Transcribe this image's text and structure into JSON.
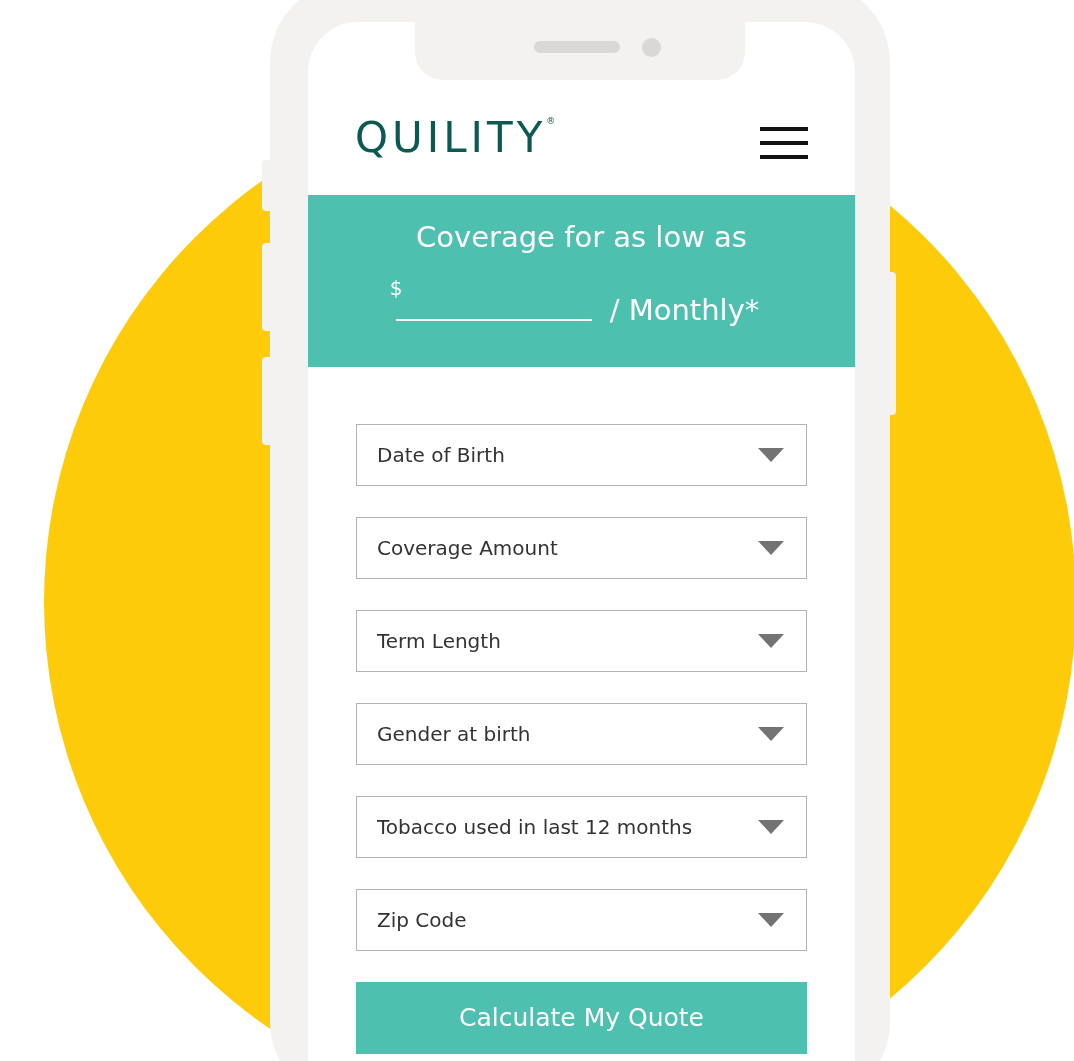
{
  "header": {
    "logo": "QUILITY",
    "logo_mark": "®"
  },
  "banner": {
    "title": "Coverage for as low as",
    "currency": "$",
    "period": "/ Monthly*"
  },
  "fields": [
    {
      "placeholder": "Date of Birth"
    },
    {
      "placeholder": "Coverage Amount"
    },
    {
      "placeholder": "Term Length"
    },
    {
      "placeholder": "Gender at birth"
    },
    {
      "placeholder": "Tobacco used in last 12 months"
    },
    {
      "placeholder": "Zip Code"
    }
  ],
  "submit_button": "Calculate My Quote"
}
